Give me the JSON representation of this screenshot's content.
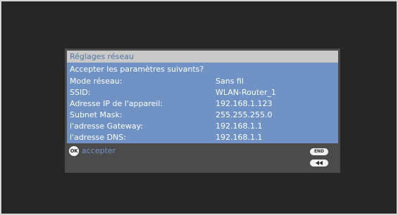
{
  "dialog": {
    "title": "Réglages réseau",
    "question": "Accepter les paramètres suivants?",
    "rows": [
      {
        "label": "Mode réseau:",
        "value": "Sans fil"
      },
      {
        "label": "SSID:",
        "value": "WLAN-Router_1"
      },
      {
        "label": "Adresse IP de l'appareil:",
        "value": "192.168.1.123"
      },
      {
        "label": "Subnet Mask:",
        "value": "255.255.255.0"
      },
      {
        "label": "l'adresse Gateway:",
        "value": "192.168.1.1"
      },
      {
        "label": "l'adresse DNS:",
        "value": "192.168.1.1"
      }
    ]
  },
  "footer": {
    "ok_icon_text": "OK",
    "ok_label": "accepter",
    "end_label": "END",
    "back_icon": "rewind-icon"
  },
  "colors": {
    "screen_bg": "#262626",
    "dialog_bg": "#4b4b4b",
    "title_bg": "#c9c9c9",
    "title_text": "#5176a5",
    "content_bg": "#7092c5",
    "accent": "#7092c5"
  }
}
